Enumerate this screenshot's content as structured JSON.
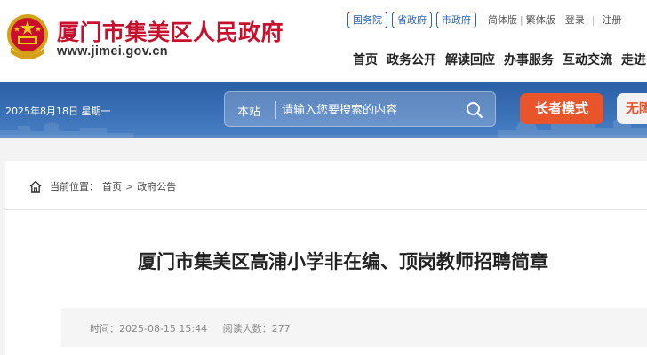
{
  "site": {
    "title": "厦门市集美区人民政府",
    "url": "www.jimei.gov.cn",
    "brand_color": "#c8102e",
    "emblem_icon": "national-emblem-icon"
  },
  "top_links": {
    "gov_links": [
      "国务院",
      "省政府",
      "市政府"
    ],
    "simplified": "简体版",
    "separator": "|",
    "traditional": "繁体版",
    "login": "登录",
    "bar": "|",
    "register": "注册"
  },
  "main_nav": [
    "首页",
    "政务公开",
    "解读回应",
    "办事服务",
    "互动交流",
    "走进"
  ],
  "banner": {
    "date": "2025年8月18日  星期一",
    "search_scope": "本站",
    "search_placeholder": "请输入您要搜索的内容",
    "search_icon": "search-icon",
    "elder_mode": "长者模式",
    "accessibility": "无障",
    "banner_color": "#3a6fb3",
    "elder_color": "#e8552a"
  },
  "breadcrumb": {
    "icon": "home-icon",
    "label": "当前位置：",
    "items": [
      "首页",
      "政府公告"
    ],
    "sep": ">"
  },
  "article": {
    "title": "厦门市集美区高浦小学非在编、顶岗教师招聘简章",
    "time_label": "时间：",
    "time": "2025-08-15 15:44",
    "views_label": "阅读人数：",
    "views": "277"
  }
}
